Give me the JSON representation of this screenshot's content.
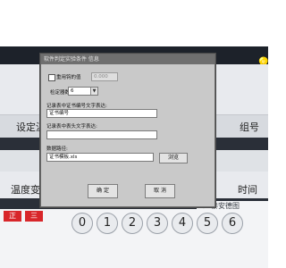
{
  "background": {
    "setting_label": "设定温",
    "group_label": "组号",
    "temp_label": "温度变",
    "time_label": "时间",
    "chips": [
      "正",
      "三"
    ],
    "keypad": [
      "0",
      "1",
      "2",
      "3",
      "4",
      "5",
      "6"
    ],
    "watermark_text": "泰安德图"
  },
  "dialog": {
    "title": "软件判定实验条件 信息",
    "reuse_label": "重用钩的值",
    "reuse_value": "0.000",
    "digits_label": "检定器数",
    "digits_value": "6",
    "cert_label": "记录表中证书编号文字表达:",
    "cert_value": "证书编号",
    "header_label": "记录表中表头文字表达:",
    "header_value": "",
    "db_label": "数据路径:",
    "db_value": "证书模板.xls",
    "browse_label": "浏览",
    "ok_label": "确 定",
    "cancel_label": "取 消"
  },
  "colors": {
    "chip_red": "#d8262a",
    "dialog_bg": "#c9c9c9",
    "titlebar_bg": "#6f6f6f"
  }
}
